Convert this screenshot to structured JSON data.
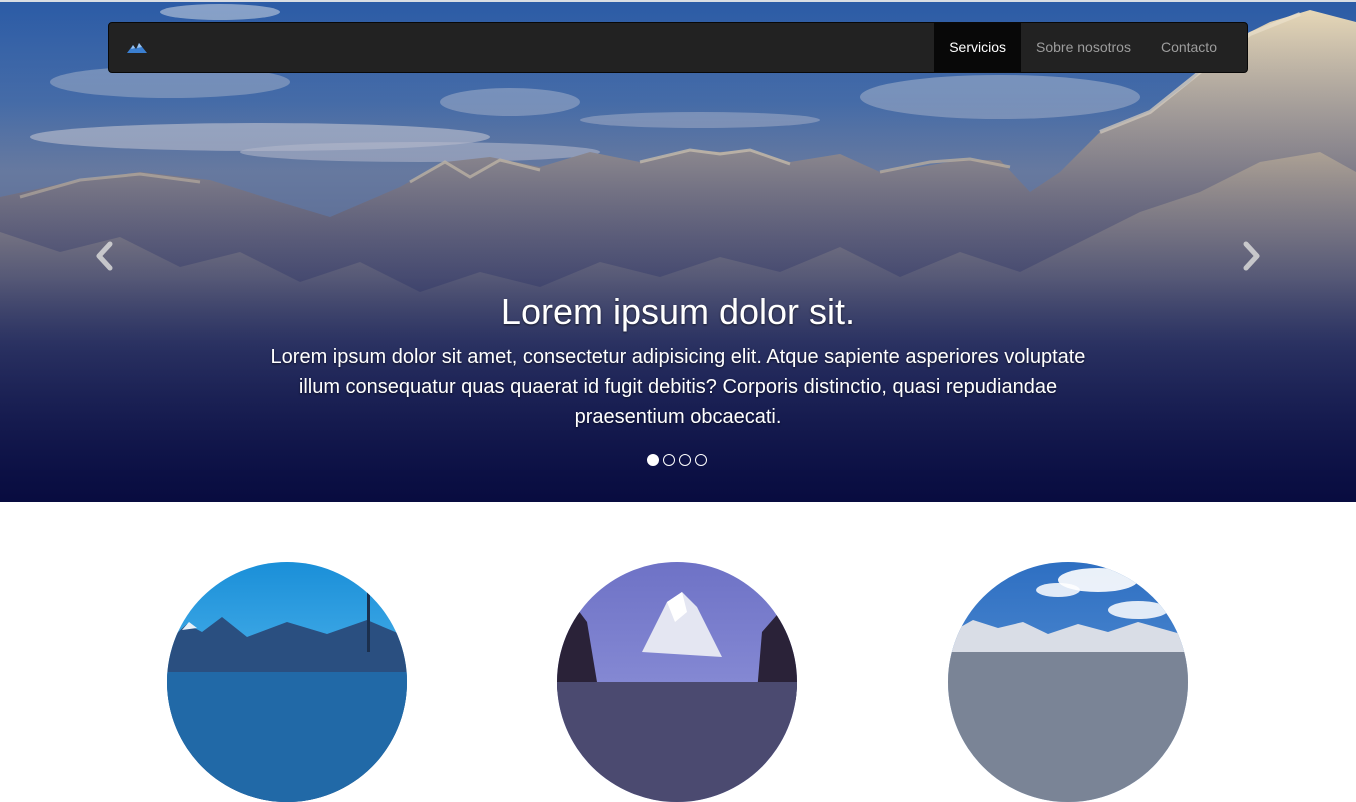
{
  "navbar": {
    "brand_icon": "mountain-logo-icon",
    "items": [
      {
        "label": "Servicios",
        "active": true
      },
      {
        "label": "Sobre nosotros",
        "active": false
      },
      {
        "label": "Contacto",
        "active": false
      }
    ]
  },
  "carousel": {
    "caption_title": "Lorem ipsum dolor sit.",
    "caption_text": "Lorem ipsum dolor sit amet, consectetur adipisicing elit. Atque sapiente asperiores voluptate illum consequatur quas quaerat id fugit debitis? Corporis distinctio, quasi repudiandae praesentium obcaecati.",
    "prev_icon": "chevron-left-icon",
    "next_icon": "chevron-right-icon",
    "slide_count": 4,
    "active_index": 0
  },
  "features": {
    "images": [
      "lake-mountain-image",
      "purple-peak-image",
      "snowy-range-image"
    ]
  },
  "colors": {
    "navbar_bg": "#222222",
    "navbar_active_bg": "#080808",
    "nav_text": "#9d9d9d",
    "nav_active_text": "#ffffff"
  }
}
